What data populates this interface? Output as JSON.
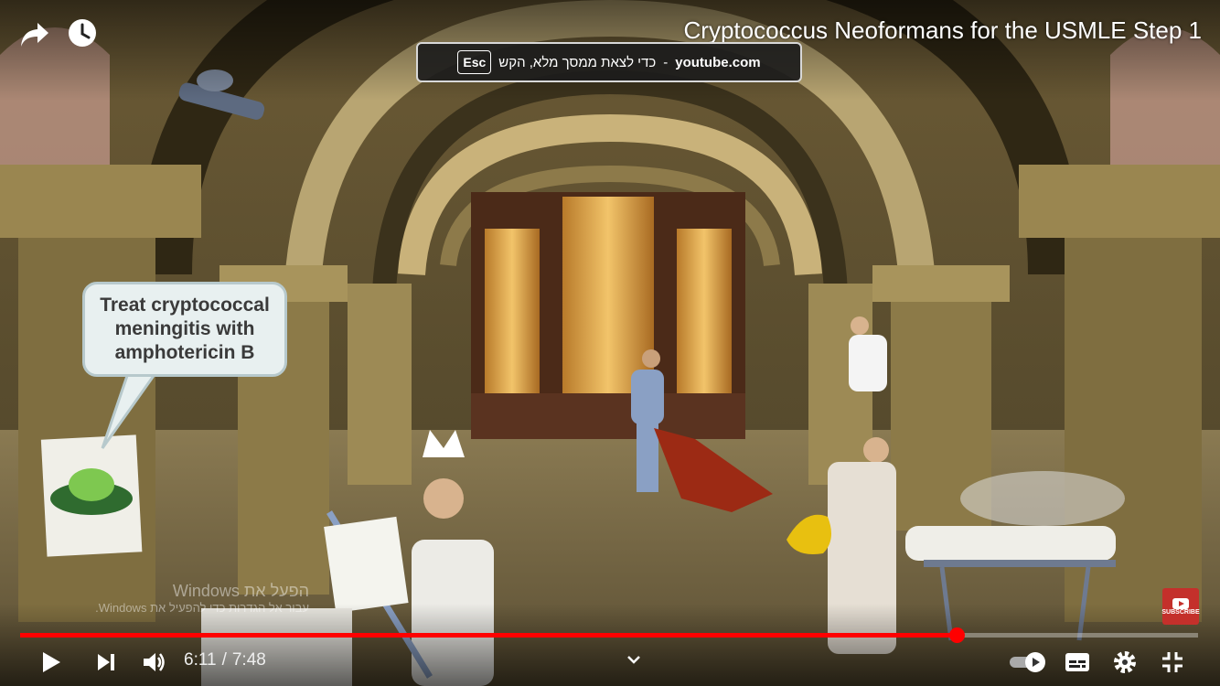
{
  "video": {
    "title": "Cryptococcus Neoformans for the USMLE Step 1",
    "speech_bubble": "Treat cryptococcal meningitis with amphotericin B",
    "progress_fraction": 0.795
  },
  "fullscreen_toast": {
    "domain": "youtube.com",
    "separator": "-",
    "message": "כדי לצאת ממסך מלא, הקש",
    "key": "Esc"
  },
  "windows_watermark": {
    "line1": "הפעל את Windows",
    "line2": "עבור אל הגדרות כדי להפעיל את Windows."
  },
  "controls": {
    "current_time": "6:11",
    "separator": "/",
    "duration": "7:48"
  },
  "subscribe_label": "SUBSCRIBE",
  "icons": {
    "share": "share-icon",
    "watch_later": "clock-icon",
    "play": "play-icon",
    "next": "next-icon",
    "volume": "volume-icon",
    "chevron": "chevron-down-icon",
    "autoplay": "autoplay-toggle-icon",
    "subtitles": "subtitles-icon",
    "settings": "gear-icon",
    "exit_fullscreen": "exit-fullscreen-icon"
  },
  "colors": {
    "progress": "#ff0000",
    "toast_bg": "#1c1c1c"
  }
}
